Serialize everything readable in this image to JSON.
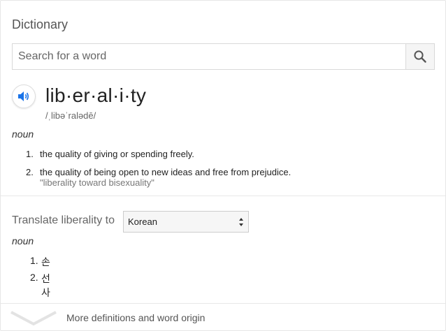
{
  "card": {
    "title": "Dictionary"
  },
  "search": {
    "placeholder": "Search for a word",
    "icon": "search-icon"
  },
  "entry": {
    "speaker_icon": "speaker-icon",
    "word": "lib·er·al·i·ty",
    "phonetic": "/ˌlibəˈralədē/",
    "part_of_speech": "noun",
    "definitions": [
      {
        "number": "1.",
        "text": "the quality of giving or spending freely."
      },
      {
        "number": "2.",
        "text": "the quality of being open to new ideas and free from prejudice.",
        "example": "\"liberality toward bisexuality\""
      }
    ]
  },
  "translate": {
    "label": "Translate liberality to",
    "selected_language": "Korean",
    "part_of_speech": "noun",
    "items": [
      {
        "number": "1.",
        "text": "손"
      },
      {
        "number": "2.",
        "text": "선사"
      }
    ]
  },
  "footer": {
    "more_label": "More definitions and word origin",
    "icon": "chevron-down-icon"
  },
  "colors": {
    "accent": "#1a73e8",
    "muted": "#777777",
    "divider": "#e8e8e8"
  }
}
